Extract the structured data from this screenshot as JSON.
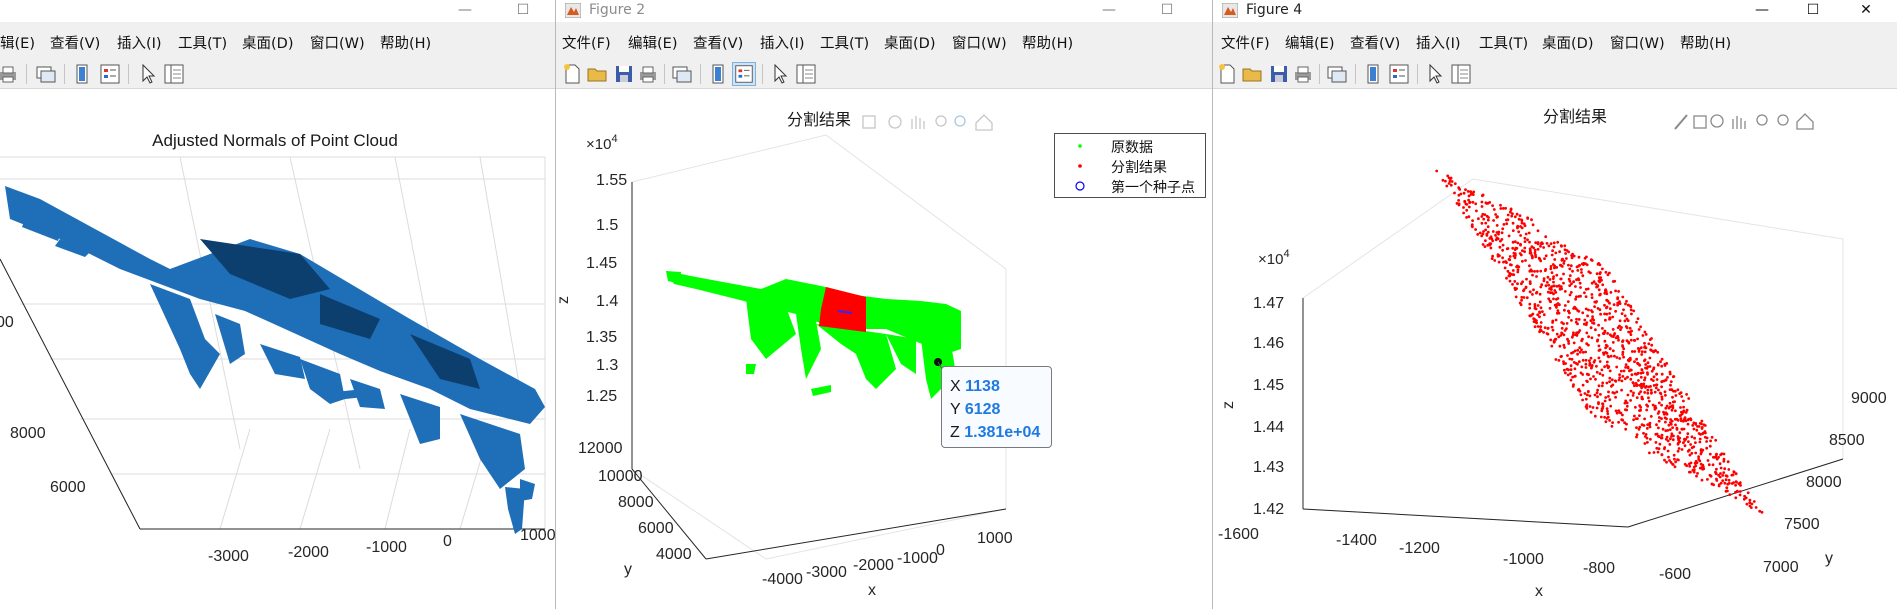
{
  "windows": [
    {
      "id": "win1",
      "title": "",
      "controls": [
        "—",
        "☐"
      ],
      "menu": [
        "辑(E)",
        "查看(V)",
        "插入(I)",
        "工具(T)",
        "桌面(D)",
        "窗口(W)",
        "帮助(H)"
      ],
      "axes": {
        "title": "Adjusted Normals of Point Cloud",
        "y_ticks": [
          "00",
          "8000",
          "6000"
        ],
        "x_ticks": [
          "-3000",
          "-2000",
          "-1000",
          "0",
          "1000"
        ]
      }
    },
    {
      "id": "win2",
      "title": "Figure 2",
      "controls": [
        "—",
        "☐"
      ],
      "menu": [
        "文件(F)",
        "编辑(E)",
        "查看(V)",
        "插入(I)",
        "工具(T)",
        "桌面(D)",
        "窗口(W)",
        "帮助(H)"
      ],
      "axes": {
        "title": "分割结果",
        "exponent": "×10",
        "exponent_power": "4",
        "z_label": "z",
        "z_ticks": [
          "1.55",
          "1.5",
          "1.45",
          "1.4",
          "1.35",
          "1.3",
          "1.25"
        ],
        "y_label": "y",
        "y_ticks": [
          "12000",
          "10000",
          "8000",
          "6000",
          "4000"
        ],
        "x_label": "x",
        "x_ticks": [
          "-4000",
          "-3000",
          "-2000",
          "-1000",
          "0",
          "1000"
        ]
      },
      "legend": [
        {
          "label": "原数据",
          "color": "#00ff00",
          "marker": "dot"
        },
        {
          "label": "分割结果",
          "color": "#ff0000",
          "marker": "dot"
        },
        {
          "label": "第一个种子点",
          "color": "#0000ff",
          "marker": "circle"
        }
      ],
      "datatip": {
        "x": "1138",
        "y": "6128",
        "z": "1.381e+04"
      }
    },
    {
      "id": "win3",
      "title": "Figure 4",
      "controls": [
        "—",
        "☐",
        "✕"
      ],
      "menu": [
        "文件(F)",
        "编辑(E)",
        "查看(V)",
        "插入(I)",
        "工具(T)",
        "桌面(D)",
        "窗口(W)",
        "帮助(H)"
      ],
      "axes": {
        "title": "分割结果",
        "exponent": "×10",
        "exponent_power": "4",
        "z_label": "z",
        "z_ticks": [
          "1.47",
          "1.46",
          "1.45",
          "1.44",
          "1.43",
          "1.42"
        ],
        "x_label": "x",
        "x_ticks": [
          "-1600",
          "-1400",
          "-1200",
          "-1000",
          "-800",
          "-600"
        ],
        "y_label": "y",
        "y_ticks": [
          "9000",
          "8500",
          "8000",
          "7500",
          "7000"
        ]
      }
    }
  ],
  "colors": {
    "cloud_blue": "#1f6fb8",
    "green": "#00ff00",
    "red": "#ff0000",
    "datatip_value": "#1f7ae0"
  }
}
